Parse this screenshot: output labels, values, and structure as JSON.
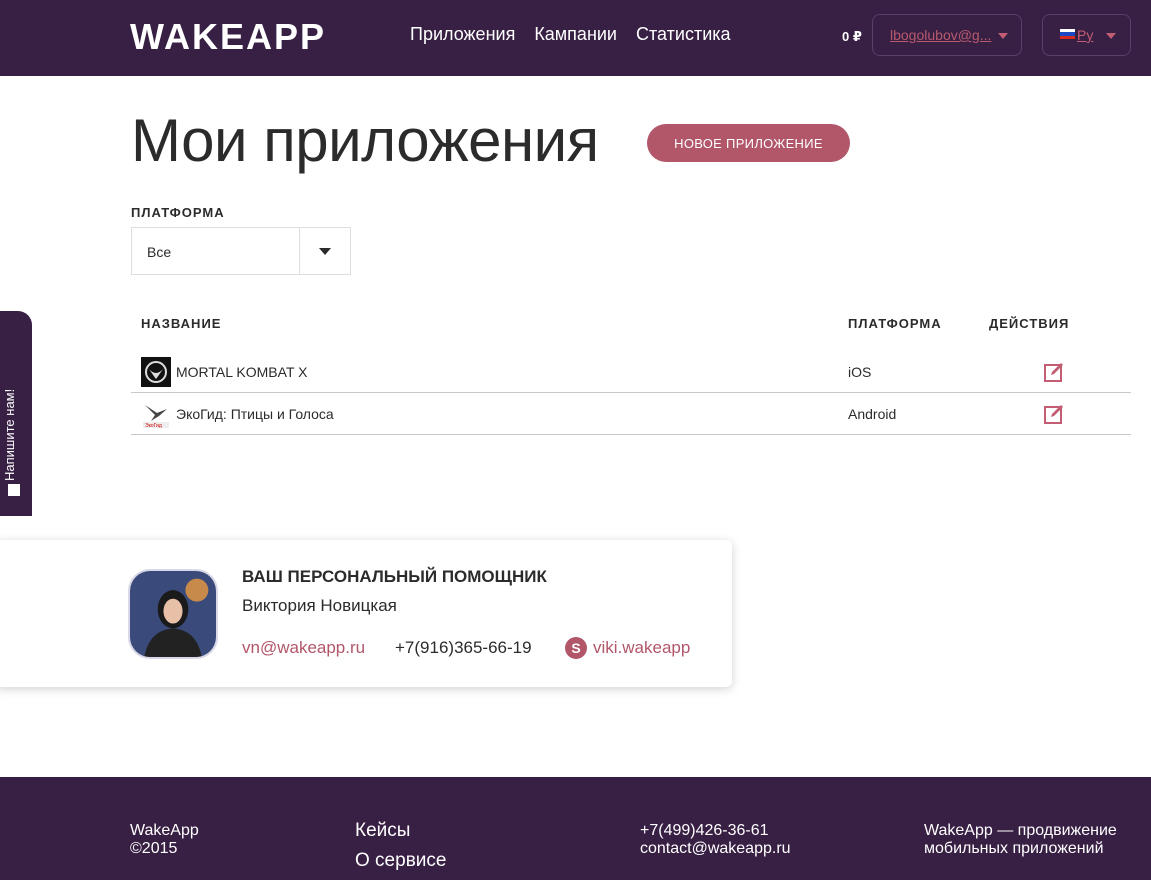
{
  "header": {
    "logo_text": "WAKEAPP",
    "nav": [
      {
        "label": "Приложения"
      },
      {
        "label": "Кампании"
      },
      {
        "label": "Статистика"
      }
    ],
    "balance": "0 ₽",
    "user_email": "lbogolubov@g...",
    "language": "Ру",
    "colors": {
      "bg": "#381f44",
      "accent": "#c25d73"
    }
  },
  "main": {
    "title": "Мои приложения",
    "new_app_button": "НОВОЕ ПРИЛОЖЕНИЕ",
    "filter": {
      "label": "ПЛАТФОРМА",
      "selected": "Все"
    },
    "table": {
      "columns": [
        "НАЗВАНИЕ",
        "ПЛАТФОРМА",
        "ДЕЙСТВИЯ"
      ],
      "rows": [
        {
          "name": "MORTAL KOMBAT X",
          "platform": "iOS",
          "icon": "mortal-kombat-icon",
          "action_icon": "edit-icon"
        },
        {
          "name": "ЭкоГид: Птицы и Голоса",
          "platform": "Android",
          "icon": "ecoguide-bird-icon",
          "action_icon": "edit-icon"
        }
      ]
    }
  },
  "side_tab": {
    "label": "Напишите нам!"
  },
  "assistant_card": {
    "title": "ВАШ ПЕРСОНАЛЬНЫЙ ПОМОЩНИК",
    "name": "Виктория Новицкая",
    "email": "vn@wakeapp.ru",
    "phone": "+7(916)365-66-19",
    "skype": "viki.wakeapp"
  },
  "footer": {
    "brand": "WakeApp",
    "copyright": "©2015",
    "links": [
      "Кейсы",
      "О сервисе"
    ],
    "contact_phone": "+7(499)426-36-61",
    "contact_email": "contact@wakeapp.ru",
    "tagline_line1": "WakeApp — продвижение",
    "tagline_line2": "мобильных приложений"
  }
}
